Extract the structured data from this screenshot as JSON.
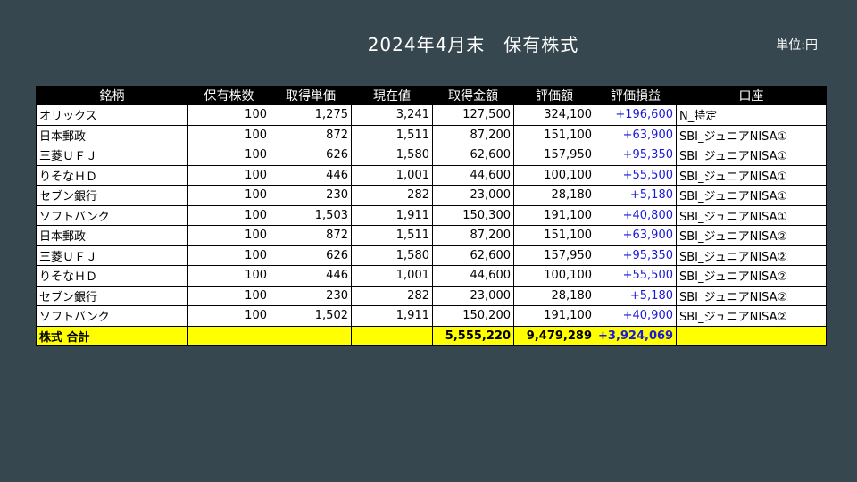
{
  "header": {
    "title": "2024年4月末　保有株式",
    "unit": "単位:円"
  },
  "table": {
    "columns": [
      "銘柄",
      "保有株数",
      "取得単価",
      "現在値",
      "取得金額",
      "評価額",
      "評価損益",
      "口座"
    ],
    "rows": [
      [
        "オリックス",
        "100",
        "1,275",
        "3,241",
        "127,500",
        "324,100",
        "+196,600",
        "N_特定"
      ],
      [
        "日本郵政",
        "100",
        "872",
        "1,511",
        "87,200",
        "151,100",
        "+63,900",
        "SBI_ジュニアNISA①"
      ],
      [
        "三菱ＵＦＪ",
        "100",
        "626",
        "1,580",
        "62,600",
        "157,950",
        "+95,350",
        "SBI_ジュニアNISA①"
      ],
      [
        "りそなＨＤ",
        "100",
        "446",
        "1,001",
        "44,600",
        "100,100",
        "+55,500",
        "SBI_ジュニアNISA①"
      ],
      [
        "セブン銀行",
        "100",
        "230",
        "282",
        "23,000",
        "28,180",
        "+5,180",
        "SBI_ジュニアNISA①"
      ],
      [
        "ソフトバンク",
        "100",
        "1,503",
        "1,911",
        "150,300",
        "191,100",
        "+40,800",
        "SBI_ジュニアNISA①"
      ],
      [
        "日本郵政",
        "100",
        "872",
        "1,511",
        "87,200",
        "151,100",
        "+63,900",
        "SBI_ジュニアNISA②"
      ],
      [
        "三菱ＵＦＪ",
        "100",
        "626",
        "1,580",
        "62,600",
        "157,950",
        "+95,350",
        "SBI_ジュニアNISA②"
      ],
      [
        "りそなＨＤ",
        "100",
        "446",
        "1,001",
        "44,600",
        "100,100",
        "+55,500",
        "SBI_ジュニアNISA②"
      ],
      [
        "セブン銀行",
        "100",
        "230",
        "282",
        "23,000",
        "28,180",
        "+5,180",
        "SBI_ジュニアNISA②"
      ],
      [
        "ソフトバンク",
        "100",
        "1,502",
        "1,911",
        "150,200",
        "191,100",
        "+40,900",
        "SBI_ジュニアNISA②"
      ]
    ],
    "total": [
      "株式 合計",
      "",
      "",
      "",
      "5,555,220",
      "9,479,289",
      "+3,924,069",
      ""
    ]
  },
  "colors": {
    "background": "#37474f",
    "header_bg": "#000000",
    "total_bg": "#ffff00",
    "gain_text": "#1a1ad8"
  }
}
